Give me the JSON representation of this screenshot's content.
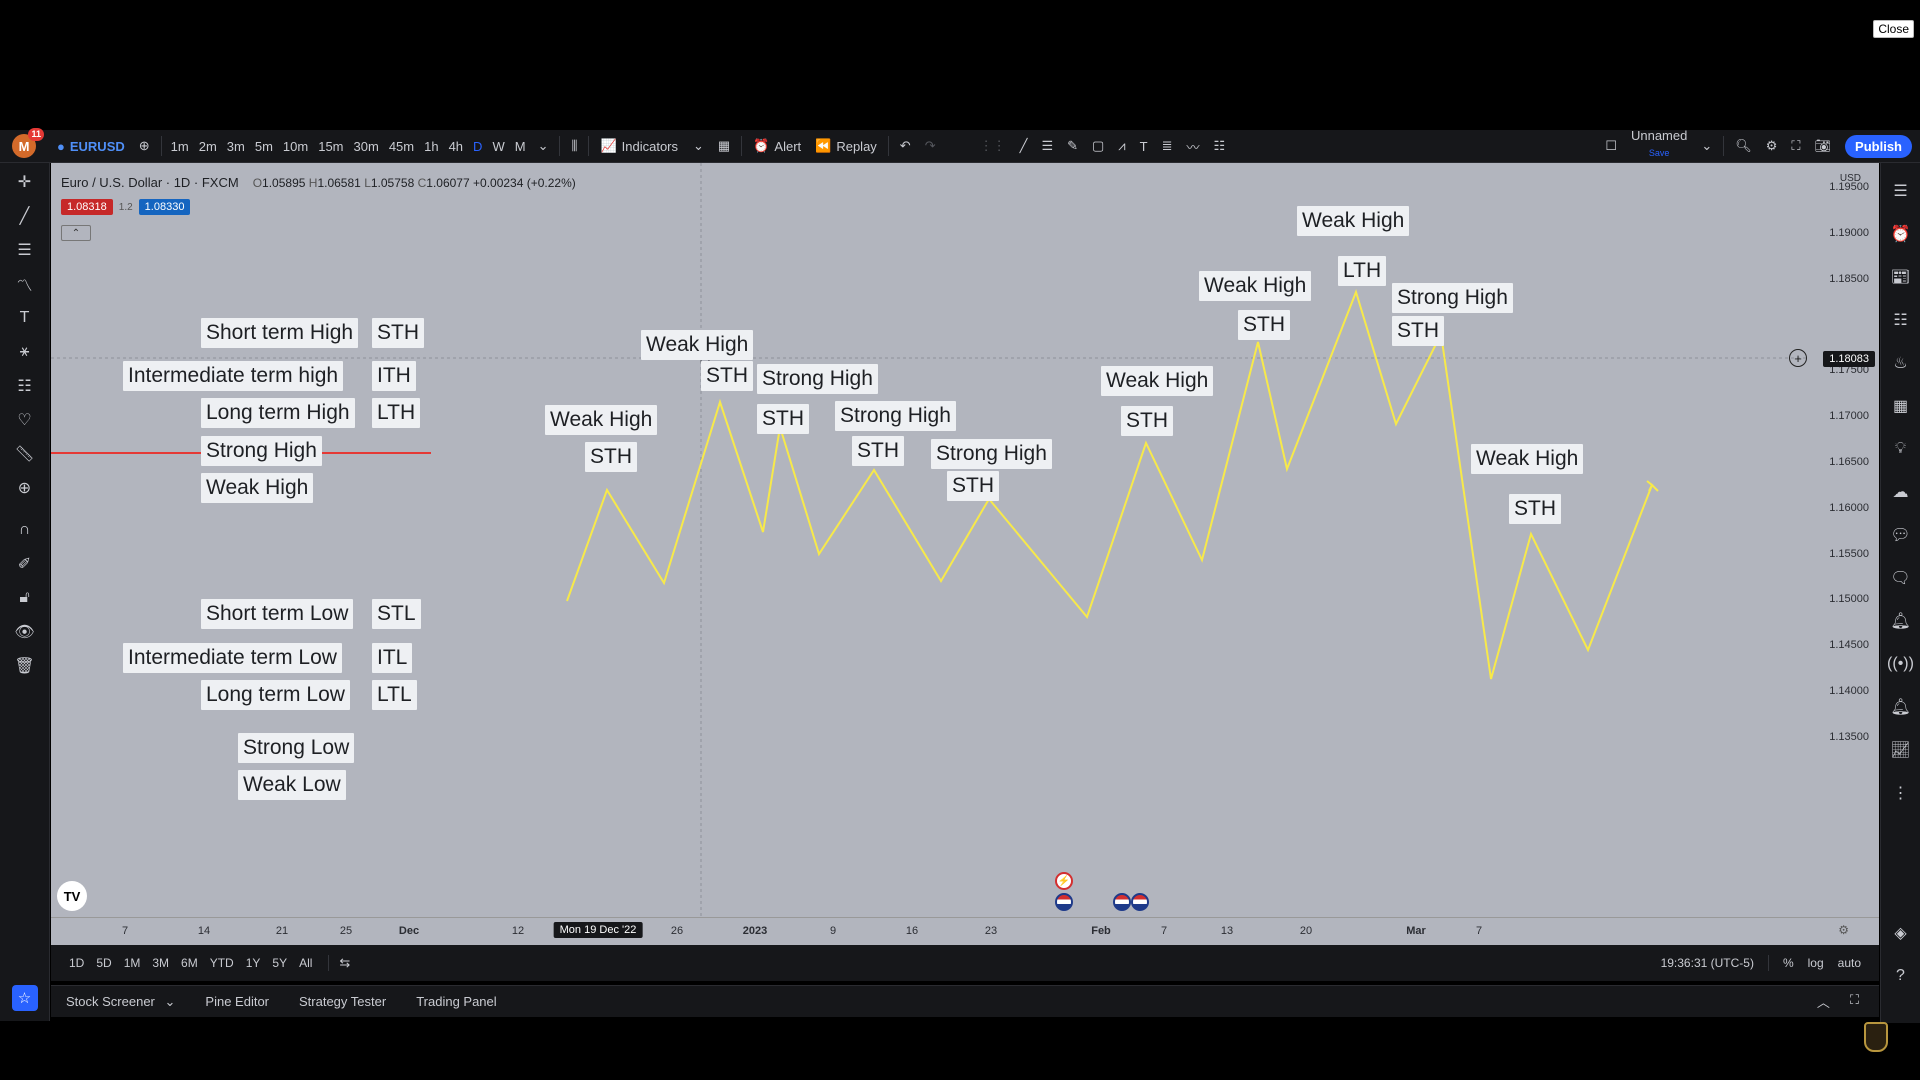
{
  "close_label": "Close",
  "topbar": {
    "avatar_letter": "M",
    "avatar_badge": "11",
    "symbol": "EURUSD",
    "timeframes": [
      "1m",
      "2m",
      "3m",
      "5m",
      "10m",
      "15m",
      "30m",
      "45m",
      "1h",
      "4h",
      "D",
      "W",
      "M"
    ],
    "active_timeframe": "D",
    "indicators_label": "Indicators",
    "alert_label": "Alert",
    "replay_label": "Replay",
    "layout_name": "Unnamed",
    "layout_status": "Save",
    "publish_label": "Publish"
  },
  "legend": {
    "title": "Euro / U.S. Dollar · 1D · FXCM",
    "open_label": "O",
    "open": "1.05895",
    "high_label": "H",
    "high": "1.06581",
    "low_label": "L",
    "low": "1.05758",
    "close_label": "C",
    "close": "1.06077",
    "change": "+0.00234 (+0.22%)",
    "sell_price": "1.08318",
    "spread": "1.2",
    "buy_price": "1.08330"
  },
  "key_labels": {
    "short_term_high": "Short term High",
    "sth": "STH",
    "intermediate_term_high": "Intermediate term high",
    "ith": "ITH",
    "long_term_high": "Long term High",
    "lth": "LTH",
    "strong_high": "Strong High",
    "weak_high": "Weak High",
    "short_term_low": "Short term Low",
    "stl": "STL",
    "intermediate_term_low": "Intermediate term Low",
    "itl": "ITL",
    "long_term_low": "Long term Low",
    "ltl": "LTL",
    "strong_low": "Strong Low",
    "weak_low": "Weak Low"
  },
  "chart_annotations": {
    "weak_high": "Weak High",
    "strong_high": "Strong High",
    "sth": "STH",
    "lth": "LTH"
  },
  "chart_colors": {
    "background": "#b2b5be",
    "zigzag": "#f7e94a",
    "separator": "#e53935"
  },
  "y_axis": {
    "currency": "USD",
    "ticks": [
      "1.19500",
      "1.19000",
      "1.18500",
      "1.17500",
      "1.17000",
      "1.16500",
      "1.16000",
      "1.15500",
      "1.15000",
      "1.14500",
      "1.14000",
      "1.13500"
    ],
    "current_price": "1.18083"
  },
  "x_axis": {
    "ticks": [
      {
        "label": "7"
      },
      {
        "label": "14"
      },
      {
        "label": "21"
      },
      {
        "label": "25"
      },
      {
        "label": "Dec"
      },
      {
        "label": "12"
      },
      {
        "label": "Mon 19 Dec '22"
      },
      {
        "label": "26"
      },
      {
        "label": "2023"
      },
      {
        "label": "9"
      },
      {
        "label": "16"
      },
      {
        "label": "23"
      },
      {
        "label": "Feb"
      },
      {
        "label": "7"
      },
      {
        "label": "13"
      },
      {
        "label": "20"
      },
      {
        "label": "Mar"
      },
      {
        "label": "7"
      }
    ]
  },
  "timebar": {
    "ranges": [
      "1D",
      "5D",
      "1M",
      "3M",
      "6M",
      "YTD",
      "1Y",
      "5Y",
      "All"
    ],
    "clock": "19:36:31 (UTC-5)",
    "percent_label": "%",
    "log_label": "log",
    "auto_label": "auto"
  },
  "panel_tabs": {
    "stock_screener": "Stock Screener",
    "pine_editor": "Pine Editor",
    "strategy_tester": "Strategy Tester",
    "trading_panel": "Trading Panel"
  },
  "tv_logo": "TV"
}
